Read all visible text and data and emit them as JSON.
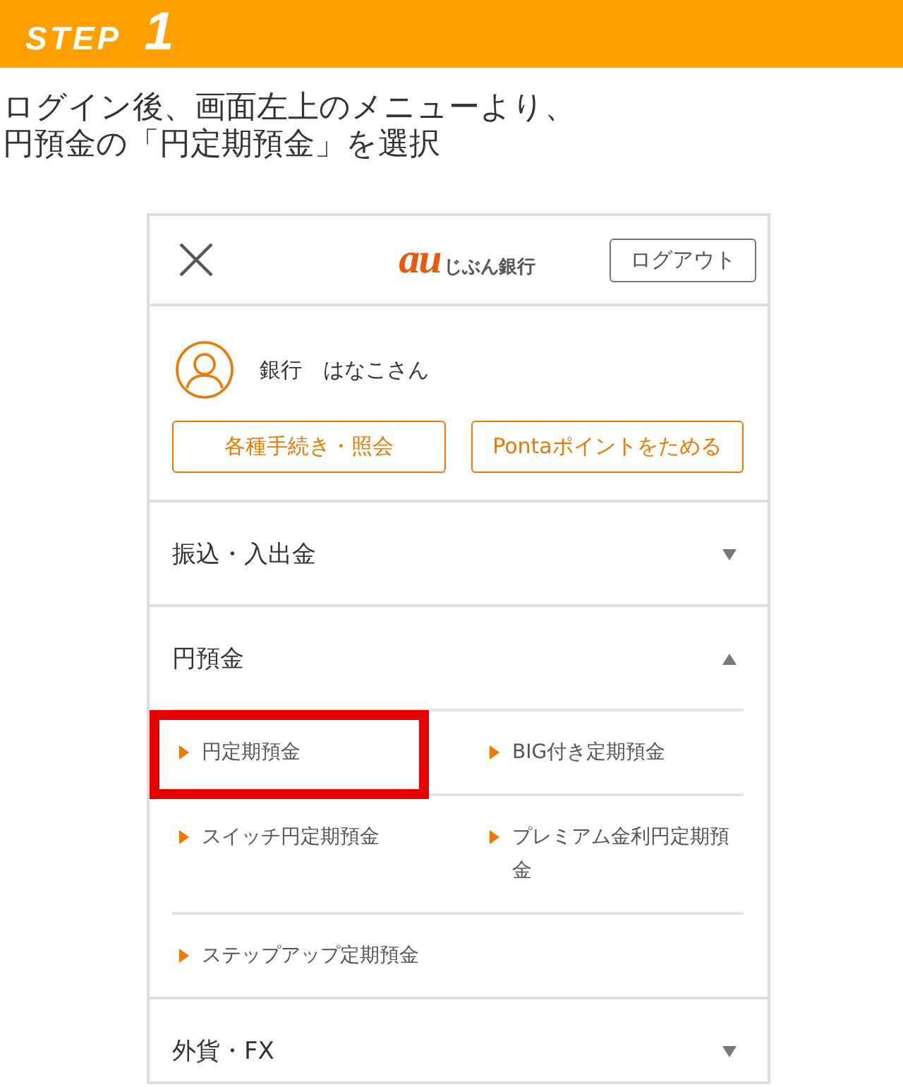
{
  "banner": {
    "label": "STEP",
    "number": "1"
  },
  "instruction": {
    "lines": [
      "ログイン後、画面左上のメニューより、",
      "円預金の「円定期預金」を選択"
    ]
  },
  "menu": {
    "logo": {
      "mark": "au",
      "name": "じぶん銀行"
    },
    "logout_button": "ログアウト",
    "user": {
      "name": "銀行　はなこさん"
    },
    "actions": [
      "各種手続き・照会",
      "Pontaポイントをためる"
    ],
    "sections": [
      {
        "label": "振込・入出金",
        "expanded": false
      },
      {
        "label": "円預金",
        "expanded": true,
        "items": [
          {
            "label": "円定期預金",
            "highlighted": true
          },
          {
            "label": "BIG付き定期預金",
            "highlighted": false
          },
          {
            "label": "スイッチ円定期預金",
            "highlighted": false
          },
          {
            "label": "プレミアム金利円定期預金",
            "highlighted": false
          },
          {
            "label": "ステップアップ定期預金",
            "highlighted": false
          }
        ]
      },
      {
        "label": "外貨・FX",
        "expanded": false
      }
    ]
  }
}
